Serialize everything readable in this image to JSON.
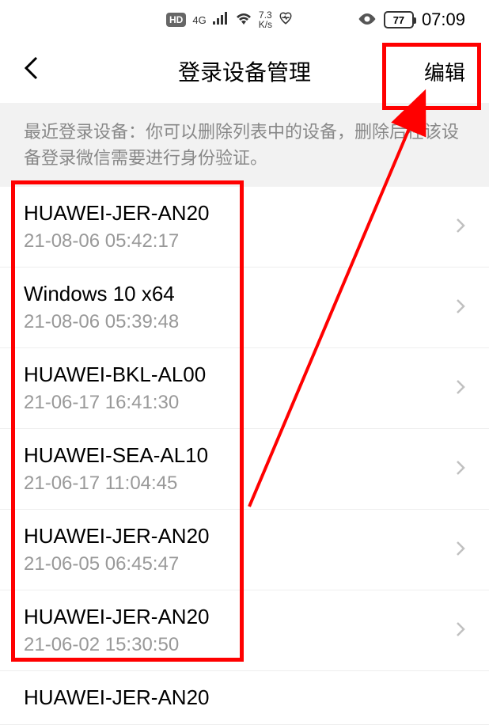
{
  "status": {
    "hd": "HD",
    "network": "4G",
    "speed_top": "7.3",
    "speed_bottom": "K/s",
    "battery": "77",
    "time": "07:09"
  },
  "nav": {
    "title": "登录设备管理",
    "edit": "编辑"
  },
  "info": "最近登录设备：你可以删除列表中的设备，删除后在该设备登录微信需要进行身份验证。",
  "devices": [
    {
      "name": "HUAWEI-JER-AN20",
      "time": "21-08-06 05:42:17"
    },
    {
      "name": "Windows 10 x64",
      "time": "21-08-06 05:39:48"
    },
    {
      "name": "HUAWEI-BKL-AL00",
      "time": "21-06-17 16:41:30"
    },
    {
      "name": "HUAWEI-SEA-AL10",
      "time": "21-06-17 11:04:45"
    },
    {
      "name": "HUAWEI-JER-AN20",
      "time": "21-06-05 06:45:47"
    },
    {
      "name": "HUAWEI-JER-AN20",
      "time": "21-06-02 15:30:50"
    },
    {
      "name": "HUAWEI-JER-AN20",
      "time": ""
    }
  ]
}
